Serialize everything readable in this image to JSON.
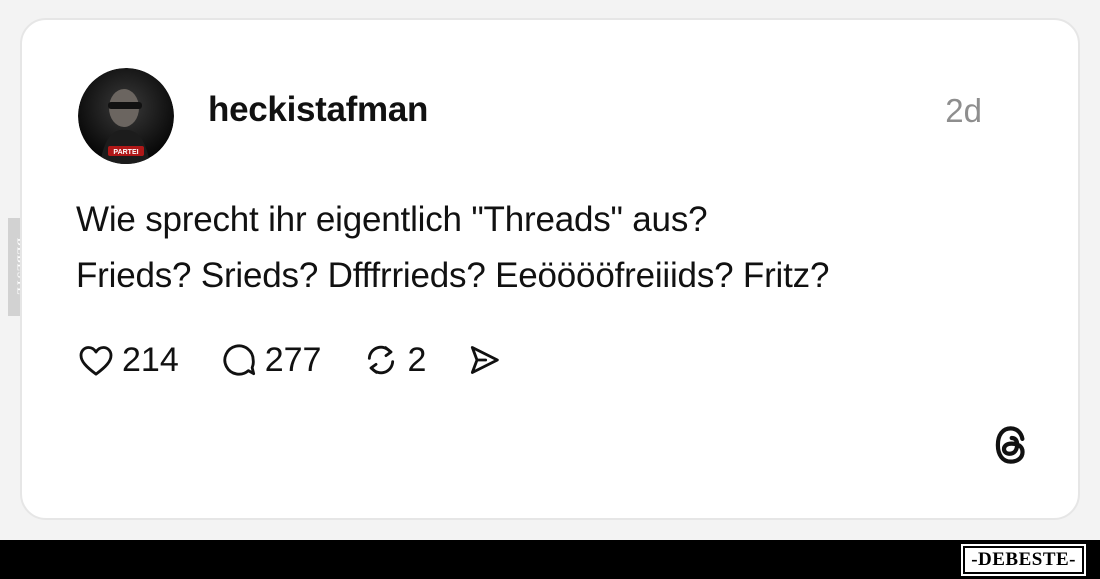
{
  "post": {
    "username": "heckistafman",
    "time": "2d",
    "avatar_badge": "PARTEI",
    "lines": [
      "Wie sprecht ihr eigentlich \"Threads\" aus?",
      "Frieds? Srieds? Dfffrrieds? Eeööööfreiiids? Fritz?"
    ],
    "actions": {
      "likes": "214",
      "comments": "277",
      "reposts": "2"
    },
    "icons": [
      "heart-icon",
      "comment-icon",
      "repost-icon",
      "share-icon",
      "threads-logo-icon"
    ]
  },
  "watermark": {
    "side": "DEBESTE",
    "brand": "-DEBESTE-"
  },
  "colors": {
    "text": "#111111",
    "muted": "#8e8e8e",
    "card": "#ffffff",
    "bar": "#000000"
  }
}
